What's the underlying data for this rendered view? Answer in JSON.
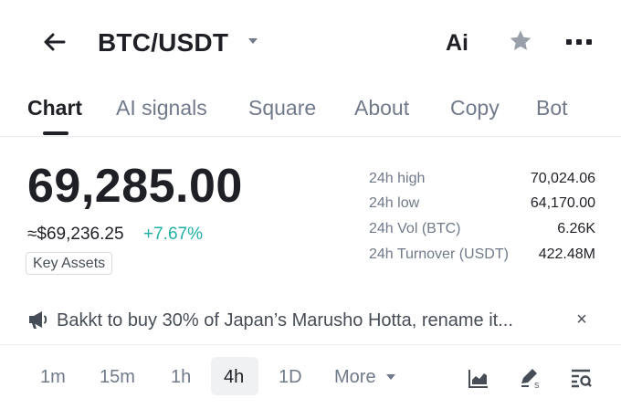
{
  "header": {
    "pair": "BTC/USDT",
    "ai_label": "Ai"
  },
  "tabs": [
    {
      "label": "Chart",
      "active": true
    },
    {
      "label": "AI signals",
      "active": false
    },
    {
      "label": "Square",
      "active": false
    },
    {
      "label": "About",
      "active": false
    },
    {
      "label": "Copy",
      "active": false
    },
    {
      "label": "Bot",
      "active": false
    }
  ],
  "price": {
    "last": "69,285.00",
    "usd": "≈$69,236.25",
    "change": "+7.67%",
    "tag": "Key Assets"
  },
  "stats": [
    {
      "label": "24h high",
      "value": "70,024.06"
    },
    {
      "label": "24h low",
      "value": "64,170.00"
    },
    {
      "label": "24h Vol (BTC)",
      "value": "6.26K"
    },
    {
      "label": "24h Turnover (USDT)",
      "value": "422.48M"
    }
  ],
  "news": {
    "text": "Bakkt to buy 30% of Japan’s Marusho Hotta, rename it...",
    "close": "×"
  },
  "timeframes": {
    "items": [
      "1m",
      "15m",
      "1h",
      "4h",
      "1D"
    ],
    "active": "4h",
    "more_label": "More"
  },
  "colors": {
    "text_primary": "#1e2026",
    "text_secondary": "#707a8a",
    "positive": "#1fb0a6",
    "divider": "#eaecef"
  },
  "icons": [
    "back-arrow-icon",
    "caret-down-icon",
    "star-icon",
    "more-dots-icon",
    "megaphone-icon",
    "close-icon",
    "chart-area-icon",
    "draw-tools-icon",
    "indicator-settings-icon"
  ]
}
